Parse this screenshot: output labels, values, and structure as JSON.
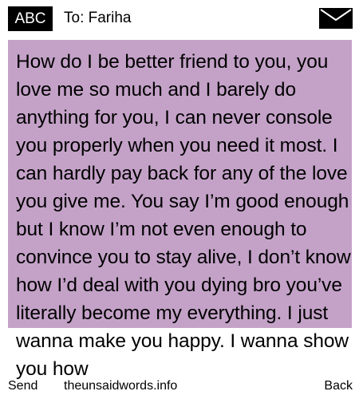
{
  "header": {
    "mode": "ABC",
    "recipient": "To: Fariha",
    "envelope_icon": "envelope-icon"
  },
  "message": {
    "body": "How do I be better friend to you, you love me so much and I barely do anything for you, I can never console you properly when you need it most. I can hardly pay back for any of the love you give me. You say I’m good enough but I know I’m not even enough to convince you to stay alive, I don’t know how I’d deal with you dying bro you’ve literally become my everything. I just wanna make you happy. I wanna show you how"
  },
  "softkeys": {
    "left": "Send",
    "center": "theunsaidwords.info",
    "right": "Back"
  },
  "colors": {
    "panel": "#c4a2c8",
    "badge": "#000000"
  }
}
